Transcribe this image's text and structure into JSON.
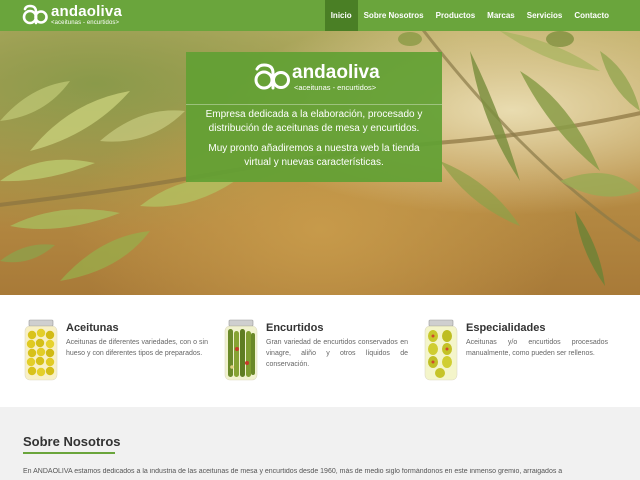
{
  "brand": {
    "name": "andaoliva",
    "tagline": "<aceitunas - encurtidos>"
  },
  "nav": {
    "items": [
      {
        "label": "Inicio",
        "active": true
      },
      {
        "label": "Sobre Nosotros",
        "active": false
      },
      {
        "label": "Productos",
        "active": false
      },
      {
        "label": "Marcas",
        "active": false
      },
      {
        "label": "Servicios",
        "active": false
      },
      {
        "label": "Contacto",
        "active": false
      }
    ]
  },
  "hero": {
    "logo_name": "andaoliva",
    "logo_tagline": "<aceitunas - encurtidos>",
    "paragraph1": "Empresa dedicada a la elaboración, procesado y distribución de aceitunas de mesa y encurtidos.",
    "paragraph2": "Muy pronto añadiremos a nuestra web la tienda virtual y nuevas características."
  },
  "features": [
    {
      "title": "Aceitunas",
      "text": "Aceitunas de diferentes variedades, con o sin hueso y con diferentes tipos de preparados.",
      "icon": "olive-jar-icon"
    },
    {
      "title": "Encurtidos",
      "text": "Gran variedad de encurtidos conservados en vinagre, aliño y otros líquidos de conservación.",
      "icon": "pickles-jar-icon"
    },
    {
      "title": "Especialidades",
      "text": "Aceitunas y/o encurtidos procesados manualmente, como pueden ser rellenos.",
      "icon": "specialties-jar-icon"
    }
  ],
  "about": {
    "title": "Sobre Nosotros",
    "text": "En ANDAOLIVA estamos dedicados a la industria de las aceitunas de mesa y encurtidos desde 1960, más de medio siglo formándonos en este inmenso gremio, arraigados a"
  },
  "colors": {
    "brand_green": "#6aa53c",
    "nav_active": "#4a7f25",
    "about_bg": "#f1f1f1"
  }
}
